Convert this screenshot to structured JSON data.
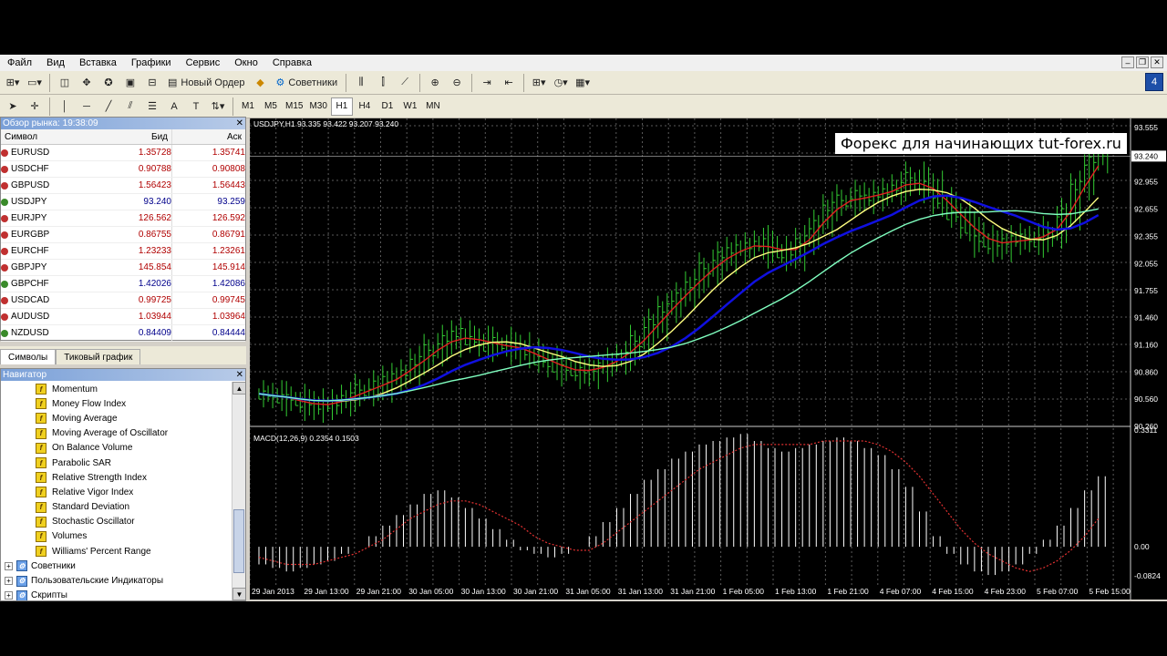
{
  "menu": [
    "Файл",
    "Вид",
    "Вставка",
    "Графики",
    "Сервис",
    "Окно",
    "Справка"
  ],
  "toolbar": {
    "new_order": "Новый Ордер",
    "experts": "Советники"
  },
  "timeframes": [
    "M1",
    "M5",
    "M15",
    "M30",
    "H1",
    "H4",
    "D1",
    "W1",
    "MN"
  ],
  "active_timeframe": "H1",
  "corner_badge": "4",
  "market_watch": {
    "title": "Обзор рынка: 19:38:09",
    "col_symbol": "Символ",
    "col_bid": "Бид",
    "col_ask": "Аск",
    "rows": [
      {
        "symbol": "EURUSD",
        "bid": "1.35728",
        "ask": "1.35741",
        "up": false
      },
      {
        "symbol": "USDCHF",
        "bid": "0.90788",
        "ask": "0.90808",
        "up": false
      },
      {
        "symbol": "GBPUSD",
        "bid": "1.56423",
        "ask": "1.56443",
        "up": false
      },
      {
        "symbol": "USDJPY",
        "bid": "93.240",
        "ask": "93.259",
        "up": true
      },
      {
        "symbol": "EURJPY",
        "bid": "126.562",
        "ask": "126.592",
        "up": false
      },
      {
        "symbol": "EURGBP",
        "bid": "0.86755",
        "ask": "0.86791",
        "up": false
      },
      {
        "symbol": "EURCHF",
        "bid": "1.23233",
        "ask": "1.23261",
        "up": false
      },
      {
        "symbol": "GBPJPY",
        "bid": "145.854",
        "ask": "145.914",
        "up": false
      },
      {
        "symbol": "GBPCHF",
        "bid": "1.42026",
        "ask": "1.42086",
        "up": true
      },
      {
        "symbol": "USDCAD",
        "bid": "0.99725",
        "ask": "0.99745",
        "up": false
      },
      {
        "symbol": "AUDUSD",
        "bid": "1.03944",
        "ask": "1.03964",
        "up": false
      },
      {
        "symbol": "NZDUSD",
        "bid": "0.84409",
        "ask": "0.84444",
        "up": true
      }
    ],
    "tabs": [
      "Символы",
      "Тиковый график"
    ]
  },
  "navigator": {
    "title": "Навигатор",
    "indicators": [
      "Momentum",
      "Money Flow Index",
      "Moving Average",
      "Moving Average of Oscillator",
      "On Balance Volume",
      "Parabolic SAR",
      "Relative Strength Index",
      "Relative Vigor Index",
      "Standard Deviation",
      "Stochastic Oscillator",
      "Volumes",
      "Williams' Percent Range"
    ],
    "groups": [
      "Советники",
      "Пользовательские Индикаторы",
      "Скрипты"
    ]
  },
  "chart": {
    "header": "USDJPY,H1  93.335 93.422 93.207 93.240",
    "watermark": "Форекс для начинающих tut-forex.ru",
    "price_labels": [
      "93.555",
      "93.240",
      "92.955",
      "92.655",
      "92.355",
      "92.055",
      "91.755",
      "91.460",
      "91.160",
      "90.860",
      "90.560",
      "90.260"
    ],
    "current_price": "93.240",
    "macd_header": "MACD(12,26,9) 0.2354 0.1503",
    "macd_labels": [
      "0.3311",
      "0.00",
      "-0.0824"
    ],
    "time_labels": [
      "29 Jan 2013",
      "29 Jan 13:00",
      "29 Jan 21:00",
      "30 Jan 05:00",
      "30 Jan 13:00",
      "30 Jan 21:00",
      "31 Jan 05:00",
      "31 Jan 13:00",
      "31 Jan 21:00",
      "1 Feb 05:00",
      "1 Feb 13:00",
      "1 Feb 21:00",
      "4 Feb 07:00",
      "4 Feb 15:00",
      "4 Feb 23:00",
      "5 Feb 07:00",
      "5 Feb 15:00"
    ]
  },
  "chart_data": {
    "type": "line",
    "symbol": "USDJPY",
    "timeframe": "H1",
    "ylim": [
      90.26,
      93.555
    ],
    "colors": {
      "bars": "#33cc33",
      "ma_red": "#e02020",
      "ma_yellow": "#ffff80",
      "ma_blue": "#1010e0",
      "ma_aqua": "#80ffc0",
      "macd_hist": "#ffffff",
      "macd_signal": "#e03030"
    },
    "close": [
      90.62,
      90.58,
      90.55,
      90.5,
      90.48,
      90.52,
      90.6,
      90.66,
      90.7,
      90.78,
      90.85,
      91.0,
      91.1,
      91.2,
      91.28,
      91.22,
      91.15,
      91.18,
      91.12,
      91.08,
      91.0,
      90.92,
      90.88,
      90.85,
      90.9,
      90.98,
      91.05,
      91.2,
      91.38,
      91.55,
      91.7,
      91.85,
      92.0,
      92.12,
      92.2,
      92.25,
      92.3,
      92.18,
      92.15,
      92.3,
      92.5,
      92.7,
      92.75,
      92.8,
      92.78,
      92.85,
      92.92,
      93.0,
      92.9,
      92.75,
      92.6,
      92.45,
      92.3,
      92.25,
      92.3,
      92.35,
      92.3,
      92.4,
      92.6,
      92.9,
      93.2,
      93.3
    ],
    "macd_hist": [
      -0.05,
      -0.06,
      -0.07,
      -0.06,
      -0.05,
      -0.04,
      -0.02,
      0.0,
      0.03,
      0.06,
      0.09,
      0.12,
      0.15,
      0.16,
      0.14,
      0.11,
      0.08,
      0.05,
      0.02,
      -0.01,
      -0.02,
      -0.03,
      -0.02,
      0.0,
      0.03,
      0.07,
      0.11,
      0.15,
      0.19,
      0.22,
      0.25,
      0.27,
      0.29,
      0.3,
      0.31,
      0.32,
      0.3,
      0.28,
      0.27,
      0.28,
      0.29,
      0.3,
      0.31,
      0.3,
      0.28,
      0.26,
      0.22,
      0.17,
      0.1,
      0.03,
      -0.02,
      -0.05,
      -0.07,
      -0.08,
      -0.07,
      -0.05,
      -0.02,
      0.02,
      0.06,
      0.11,
      0.16,
      0.2
    ],
    "macd_signal": [
      -0.03,
      -0.04,
      -0.05,
      -0.05,
      -0.05,
      -0.04,
      -0.03,
      -0.02,
      0.0,
      0.02,
      0.05,
      0.08,
      0.1,
      0.12,
      0.13,
      0.13,
      0.12,
      0.1,
      0.08,
      0.06,
      0.03,
      0.01,
      0.0,
      -0.01,
      -0.01,
      0.01,
      0.04,
      0.07,
      0.1,
      0.13,
      0.16,
      0.19,
      0.22,
      0.24,
      0.26,
      0.28,
      0.29,
      0.29,
      0.29,
      0.29,
      0.29,
      0.3,
      0.3,
      0.3,
      0.3,
      0.29,
      0.27,
      0.24,
      0.2,
      0.15,
      0.1,
      0.05,
      0.01,
      -0.02,
      -0.04,
      -0.06,
      -0.07,
      -0.06,
      -0.04,
      -0.01,
      0.03,
      0.08
    ]
  }
}
